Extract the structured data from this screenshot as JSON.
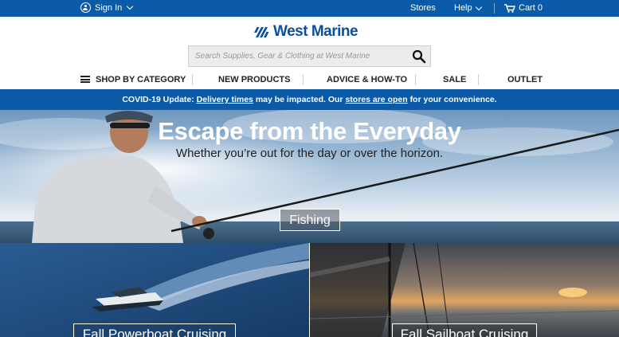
{
  "topbar": {
    "sign_in": "Sign In",
    "stores": "Stores",
    "help": "Help",
    "cart": "Cart 0",
    "background": "#0b5aa7"
  },
  "logo": {
    "text": "West Marine",
    "color": "#0b4f9c"
  },
  "search": {
    "placeholder": "Search Supplies, Gear & Clothing at West Marine",
    "value": ""
  },
  "nav": {
    "items": [
      "SHOP BY CATEGORY",
      "NEW PRODUCTS",
      "ADVICE & HOW-TO",
      "SALE",
      "OUTLET"
    ]
  },
  "banner": {
    "prefix": "COVID-19 Update:",
    "link1": "Delivery times",
    "middle": "may be impacted. Our",
    "link2": "stores are open",
    "suffix": "for your convenience."
  },
  "hero": {
    "title": "Escape from the Everyday",
    "subtitle": "Whether you’re out for the day or over the horizon.",
    "button": "Fishing"
  },
  "tiles": [
    {
      "label": "Fall Powerboat Cruising"
    },
    {
      "label": "Fall Sailboat Cruising"
    }
  ],
  "icons": [
    "user-icon",
    "chevron-down-icon",
    "cart-icon",
    "search-icon",
    "menu-icon",
    "logo-icon"
  ]
}
